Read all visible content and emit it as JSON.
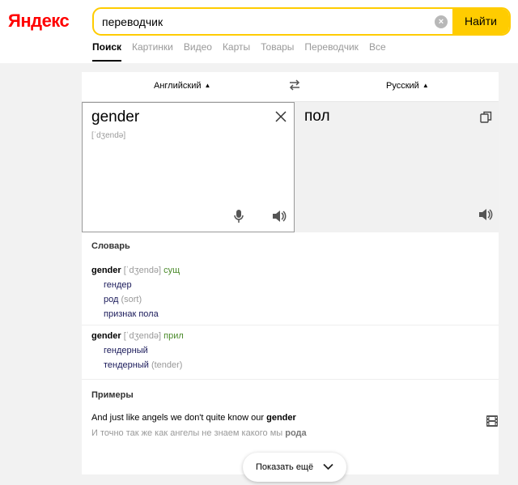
{
  "header": {
    "logo": "Яндекс",
    "search_value": "переводчик",
    "clear_label": "×",
    "search_button": "Найти"
  },
  "nav": [
    {
      "label": "Поиск",
      "active": true
    },
    {
      "label": "Картинки"
    },
    {
      "label": "Видео"
    },
    {
      "label": "Карты"
    },
    {
      "label": "Товары"
    },
    {
      "label": "Переводчик"
    },
    {
      "label": "Все"
    }
  ],
  "translator": {
    "source_lang": "Английский",
    "target_lang": "Русский",
    "source_text": "gender",
    "transcription": "[ˈdʒendə]",
    "translation": "пол"
  },
  "dictionary": {
    "title": "Словарь",
    "entries": [
      {
        "word": "gender",
        "transcription": "[ˈdʒendə]",
        "pos": "сущ",
        "lines": [
          {
            "text": "гендер",
            "hint": ""
          },
          {
            "text": "род",
            "hint": "(sort)"
          },
          {
            "text": "признак пола",
            "hint": ""
          }
        ]
      },
      {
        "word": "gender",
        "transcription": "[ˈdʒendə]",
        "pos": "прил",
        "lines": [
          {
            "text": "гендерный",
            "hint": ""
          },
          {
            "text": "тендерный",
            "hint": "(tender)"
          }
        ]
      }
    ]
  },
  "examples": {
    "title": "Примеры",
    "en_before": "And just like angels we don't quite know our ",
    "en_bold": "gender",
    "ru_before": "И точно так же как ангелы не знаем какого мы ",
    "ru_bold": "рода"
  },
  "more_button": "Показать ещё",
  "colors": {
    "brand_red": "#ff0000",
    "search_accent": "#ffcc00",
    "pos_green": "#4a8a2a",
    "background": "#f2f2f2"
  }
}
